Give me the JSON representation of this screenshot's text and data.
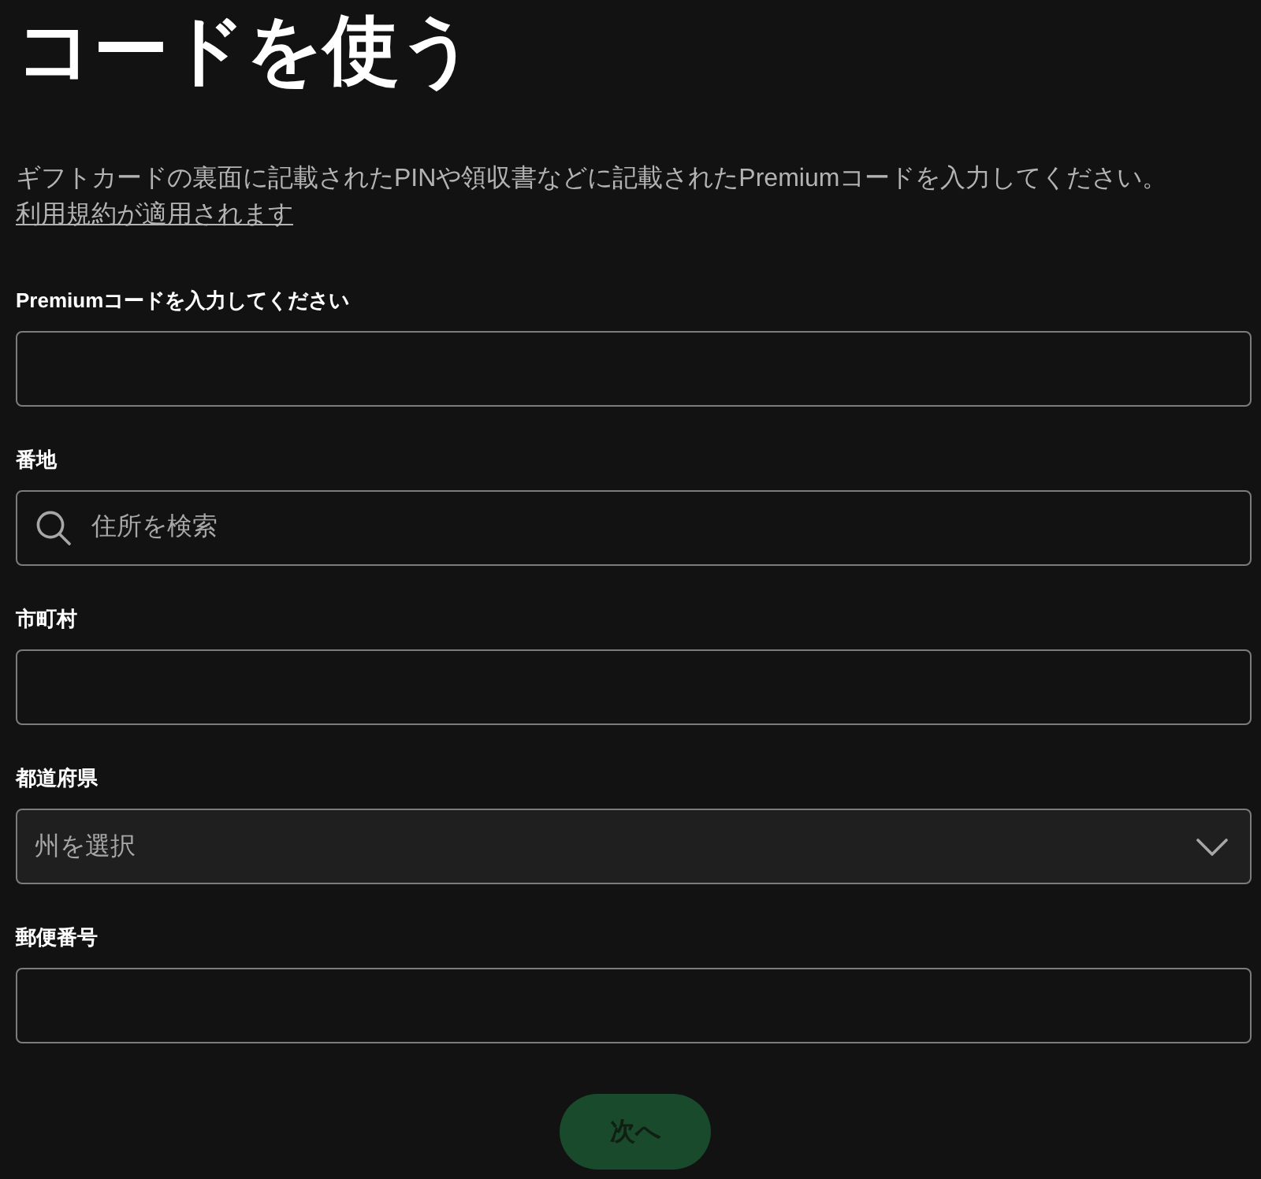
{
  "title": "コードを使う",
  "description": {
    "text": "ギフトカードの裏面に記載されたPINや領収書などに記載されたPremiumコードを入力してください。",
    "link": "利用規約が適用されます"
  },
  "fields": [
    {
      "label": "Premiumコードを入力してください",
      "kind": "text"
    },
    {
      "label": "番地",
      "kind": "search",
      "placeholder": "住所を検索"
    },
    {
      "label": "市町村",
      "kind": "text"
    },
    {
      "label": "都道府県",
      "kind": "select",
      "placeholder": "州を選択"
    },
    {
      "label": "郵便番号",
      "kind": "text"
    }
  ],
  "next_button": {
    "label": "次へ",
    "disabled": true
  }
}
